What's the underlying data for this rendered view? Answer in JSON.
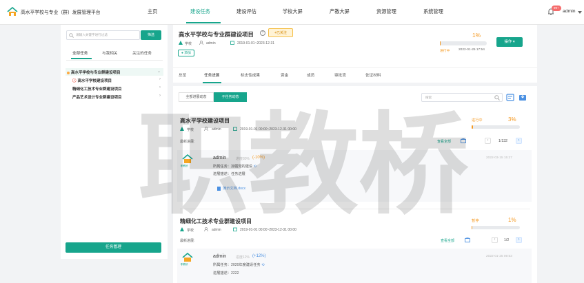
{
  "app": {
    "title": "高水平学校与专业（群）发展管理平台"
  },
  "nav": {
    "items": [
      "主页",
      "建设任务",
      "建设评估",
      "学校大屏",
      "产教大屏",
      "资源管理",
      "系统管理"
    ],
    "active_index": 1
  },
  "user": {
    "name": "admin",
    "badge": "99+"
  },
  "left": {
    "search_placeholder": "请输入关键字进行过滤",
    "search_button": "筛选",
    "tabs": [
      "全部任务",
      "与我相关",
      "关注的任务"
    ],
    "tree": [
      {
        "label": "高水平学校与专业群建设项目",
        "selected": true
      },
      {
        "label": "高水平学校建设项目",
        "warn": true
      },
      {
        "label": "精细化工技术专业群建设项目"
      },
      {
        "label": "产品艺术设计专业群建设项目"
      }
    ],
    "manage_button": "任务管理"
  },
  "project": {
    "title": "高水平学校与专业群建设项目",
    "help": "?",
    "follow": "+已关注",
    "dept": "学校",
    "owner": "admin",
    "period": "2019-01-01~2023-12-31",
    "tag": "添加",
    "percent": "1%",
    "percent_value": 1,
    "status": "进行中",
    "update_date": "2022-01-25 17:54",
    "ops_button": "操作 ▾",
    "tabs": [
      "总览",
      "任务进展",
      "标志性成果",
      "资金",
      "成员",
      "审批流",
      "佐证材料"
    ]
  },
  "feed": {
    "seg_all": "全部进展动态",
    "seg_sub": "子任务动态",
    "search_placeholder": "搜索",
    "cards": [
      {
        "title": "高水平学校建设项目",
        "status": "进行中",
        "percent": "3%",
        "percent_value": 3,
        "dept": "学校",
        "owner": "admin",
        "period": "2019-01-01 00:00~2023-12-31 00:00",
        "latest": "最新进展:",
        "view_all": "查看全部",
        "pager": "1/132",
        "entry": {
          "avatar_label": "职教桥",
          "user": "admin",
          "progress": "进度80%",
          "change": "(-10%)",
          "date": "2022-03-15 15:27",
          "task_label": "所属任务：",
          "task_value": "加强党的建设",
          "desc_label": "进展描述：",
          "desc_value": "任务进展",
          "attachment": "演示文档.docx"
        }
      },
      {
        "title": "精细化工技术专业群建设项目",
        "status": "暂停",
        "percent": "1%",
        "percent_value": 1,
        "dept": "学校",
        "owner": "admin",
        "period": "2019-01-01 00:00~2023-12-31 00:00",
        "latest": "最新进展:",
        "view_all": "查看全部",
        "pager": "1/2",
        "entry": {
          "avatar_label": "职教桥",
          "user": "admin",
          "progress": "进度12%",
          "change": "(+12%)",
          "date": "2022-01-25 09:53",
          "task_label": "所属任务：",
          "task_value": "2020年度建设任务",
          "desc_label": "进展描述：",
          "desc_value": "2222"
        }
      }
    ]
  },
  "watermark": {
    "text": "职教桥"
  },
  "colors": {
    "accent": "#17a58c",
    "warning": "#f59a23",
    "link": "#4a90e2"
  }
}
